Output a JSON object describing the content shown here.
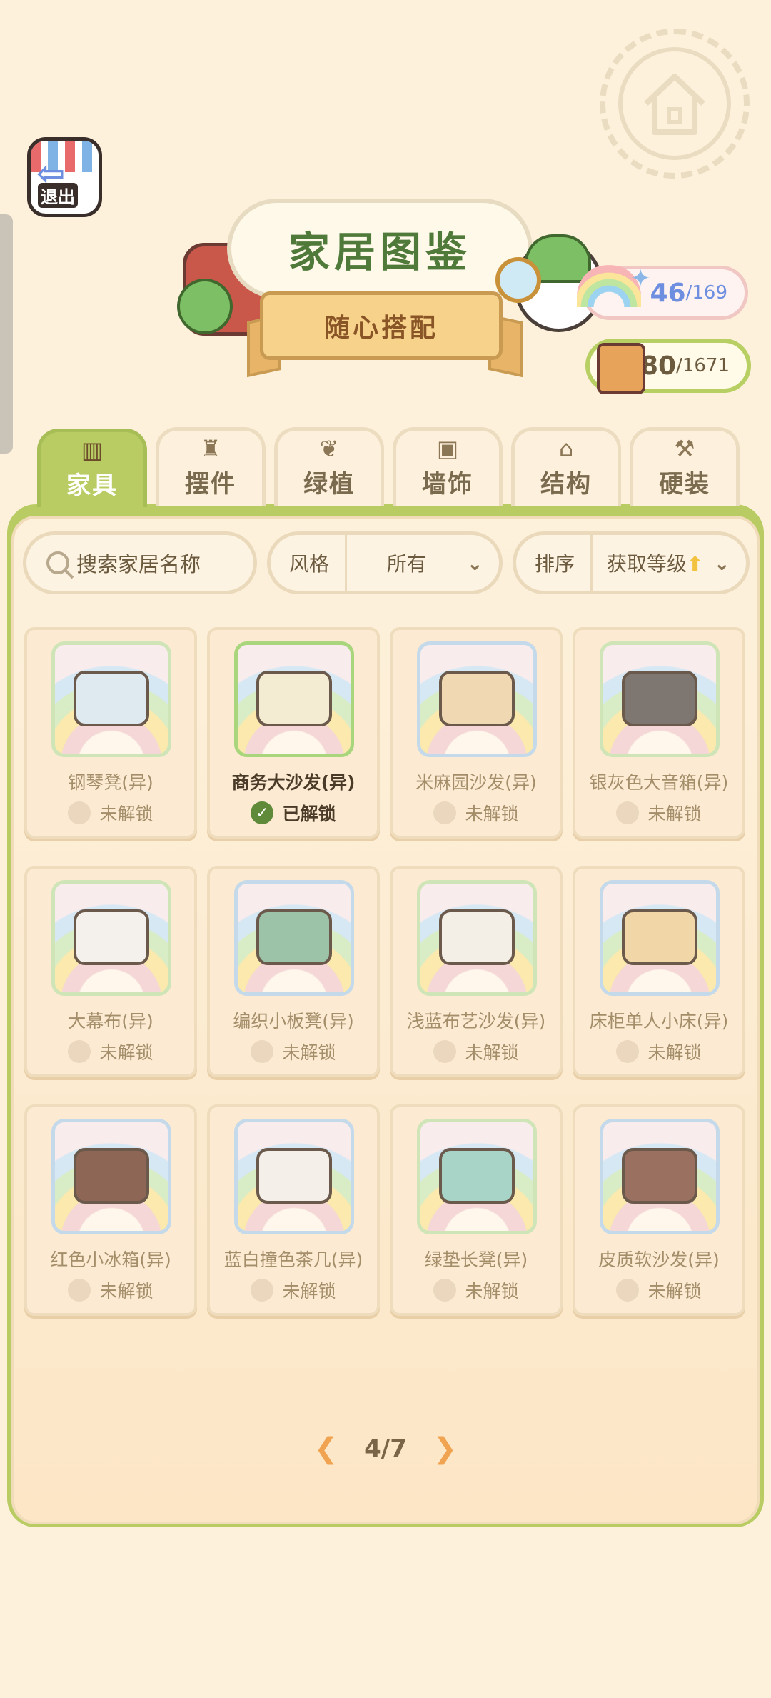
{
  "header": {
    "exit_label": "退出",
    "title": "家居图鉴",
    "subtitle": "随心搭配"
  },
  "counters": {
    "rainbow": {
      "value": "46",
      "total": "/169"
    },
    "book": {
      "value": "580",
      "total": "/1671"
    }
  },
  "tabs": [
    {
      "label": "家具",
      "icon": "chair-icon",
      "glyph": "▥",
      "active": true
    },
    {
      "label": "摆件",
      "icon": "lamp-icon",
      "glyph": "♜",
      "active": false
    },
    {
      "label": "绿植",
      "icon": "leaf-icon",
      "glyph": "❦",
      "active": false
    },
    {
      "label": "墙饰",
      "icon": "picture-icon",
      "glyph": "▣",
      "active": false
    },
    {
      "label": "结构",
      "icon": "house-icon",
      "glyph": "⌂",
      "active": false
    },
    {
      "label": "硬装",
      "icon": "hammer-icon",
      "glyph": "⚒",
      "active": false
    }
  ],
  "filters": {
    "search_placeholder": "搜索家居名称",
    "style_label": "风格",
    "style_value": "所有",
    "sort_label": "排序",
    "sort_value": "获取等级"
  },
  "items": [
    {
      "name": "钢琴凳(异)",
      "status": "未解锁",
      "unlocked": false,
      "frame": "green",
      "color": "#dfe9f0"
    },
    {
      "name": "商务大沙发(异)",
      "status": "已解锁",
      "unlocked": true,
      "frame": "brightgreen",
      "color": "#f3ecd3"
    },
    {
      "name": "米麻园沙发(异)",
      "status": "未解锁",
      "unlocked": false,
      "frame": "blue",
      "color": "#f0d9b2"
    },
    {
      "name": "银灰色大音箱(异)",
      "status": "未解锁",
      "unlocked": false,
      "frame": "green",
      "color": "#7e7670"
    },
    {
      "name": "大幕布(异)",
      "status": "未解锁",
      "unlocked": false,
      "frame": "green",
      "color": "#f4f1ec"
    },
    {
      "name": "编织小板凳(异)",
      "status": "未解锁",
      "unlocked": false,
      "frame": "blue",
      "color": "#9cc3a8"
    },
    {
      "name": "浅蓝布艺沙发(异)",
      "status": "未解锁",
      "unlocked": false,
      "frame": "green",
      "color": "#f3efe6"
    },
    {
      "name": "床柜单人小床(异)",
      "status": "未解锁",
      "unlocked": false,
      "frame": "blue",
      "color": "#f1d6a8"
    },
    {
      "name": "红色小冰箱(异)",
      "status": "未解锁",
      "unlocked": false,
      "frame": "blue",
      "color": "#8d6656"
    },
    {
      "name": "蓝白撞色茶几(异)",
      "status": "未解锁",
      "unlocked": false,
      "frame": "blue",
      "color": "#f4efe8"
    },
    {
      "name": "绿垫长凳(异)",
      "status": "未解锁",
      "unlocked": false,
      "frame": "green",
      "color": "#a8d4c8"
    },
    {
      "name": "皮质软沙发(异)",
      "status": "未解锁",
      "unlocked": false,
      "frame": "blue",
      "color": "#9a7060"
    }
  ],
  "pager": {
    "current": "4/7"
  }
}
